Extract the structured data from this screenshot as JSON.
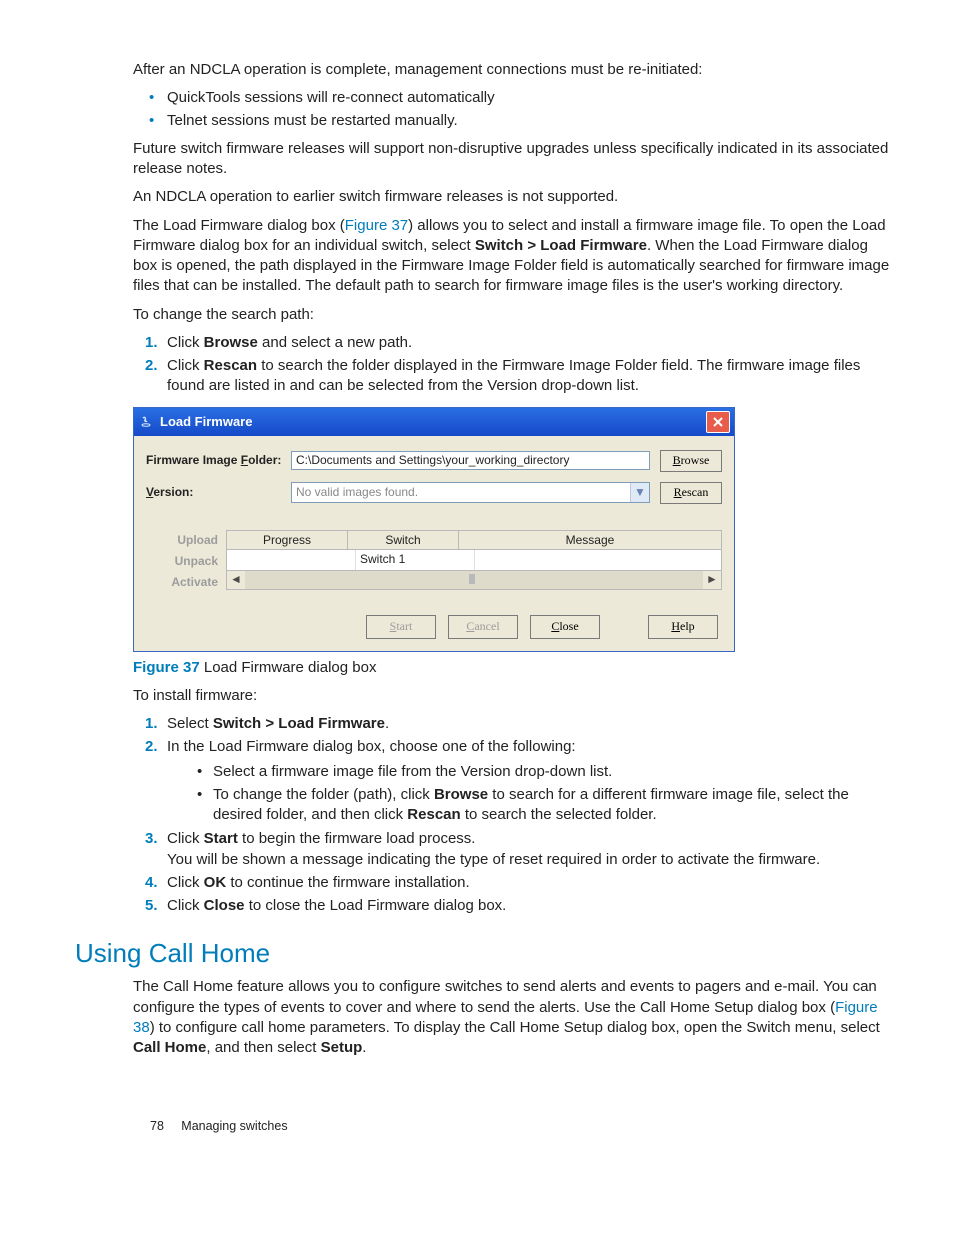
{
  "intro": {
    "p1": "After an NDCLA operation is complete, management connections must be re-initiated:",
    "b1": "QuickTools sessions will re-connect automatically",
    "b2": "Telnet sessions must be restarted manually.",
    "p2": "Future switch firmware releases will support non-disruptive upgrades unless specifically indicated in its associated release notes.",
    "p3": "An NDCLA operation to earlier switch firmware releases is not supported.",
    "p4a": "The Load Firmware dialog box (",
    "p4link": "Figure 37",
    "p4b": ") allows you to select and install a firmware image file. To open the Load Firmware dialog box for an individual switch, select ",
    "p4bold": "Switch > Load Firmware",
    "p4c": ". When the Load Firmware dialog box is opened, the path displayed in the Firmware Image Folder field is automatically searched for firmware image files that can be installed. The default path to search for firmware image files is the user's working directory.",
    "p5": "To change the search path:"
  },
  "steps1": {
    "s1a": "Click ",
    "s1b": "Browse",
    "s1c": " and select a new path.",
    "s2a": "Click ",
    "s2b": "Rescan",
    "s2c": " to search the folder displayed in the Firmware Image Folder field. The firmware image files found are listed in and can be selected from the Version drop-down list."
  },
  "dialog": {
    "title": "Load Firmware",
    "folder_label_pre": "Firmware Image ",
    "folder_label_u": "F",
    "folder_label_post": "older:",
    "folder_value": "C:\\Documents and Settings\\your_working_directory",
    "version_label_u": "V",
    "version_label_post": "ersion:",
    "version_value": "No valid images found.",
    "browse_u": "B",
    "browse_rest": "rowse",
    "rescan_u": "R",
    "rescan_rest": "escan",
    "steps": {
      "upload": "Upload",
      "unpack": "Unpack",
      "activate": "Activate"
    },
    "cols": {
      "progress": "Progress",
      "switch": "Switch",
      "message": "Message"
    },
    "row": {
      "switch": "Switch 1"
    },
    "buttons": {
      "start_u": "S",
      "start_rest": "tart",
      "cancel_u": "C",
      "cancel_rest": "ancel",
      "close_u": "C",
      "close_rest": "lose",
      "help_u": "H",
      "help_rest": "elp"
    }
  },
  "caption": {
    "label": "Figure 37",
    "text": " Load Firmware dialog box"
  },
  "install": {
    "intro": "To install firmware:",
    "s1a": "Select ",
    "s1b": "Switch > Load Firmware",
    "s1c": ".",
    "s2": "In the Load Firmware dialog box, choose one of the following:",
    "s2b1": "Select a firmware image file from the Version drop-down list.",
    "s2b2a": "To change the folder (path), click ",
    "s2b2b": "Browse",
    "s2b2c": " to search for a different firmware image file, select the desired folder, and then click ",
    "s2b2d": "Rescan",
    "s2b2e": " to search the selected folder.",
    "s3a": "Click ",
    "s3b": "Start",
    "s3c": " to begin the firmware load process.",
    "s3d": "You will be shown a message indicating the type of reset required in order to activate the firmware.",
    "s4a": "Click ",
    "s4b": "OK",
    "s4c": " to continue the firmware installation.",
    "s5a": "Click ",
    "s5b": "Close",
    "s5c": " to close the Load Firmware dialog box."
  },
  "section": {
    "title": "Using Call Home",
    "p1a": "The Call Home feature allows you to configure switches to send alerts and events to pagers and e-mail. You can configure the types of events to cover and where to send the alerts. Use the Call Home Setup dialog box (",
    "p1link": "Figure 38",
    "p1b": ") to configure call home parameters. To display the Call Home Setup dialog box, open the Switch menu, select ",
    "p1bold1": "Call Home",
    "p1c": ", and then select ",
    "p1bold2": "Setup",
    "p1d": "."
  },
  "footer": {
    "page": "78",
    "title": "Managing switches"
  }
}
